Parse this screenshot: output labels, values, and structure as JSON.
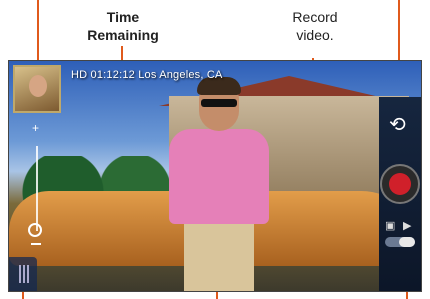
{
  "callouts": {
    "time_remaining": "Time Remaining",
    "record_video": "Record video."
  },
  "hud": {
    "status_line": "HD  01:12:12  Los Angeles, CA"
  },
  "icons": {
    "switch_camera": "switch-camera-icon",
    "camera": "camera-icon",
    "video": "video-icon",
    "record": "record-icon"
  },
  "colors": {
    "callout_line": "#e05a1c",
    "record": "#d0202a",
    "panel": "#16263f"
  }
}
